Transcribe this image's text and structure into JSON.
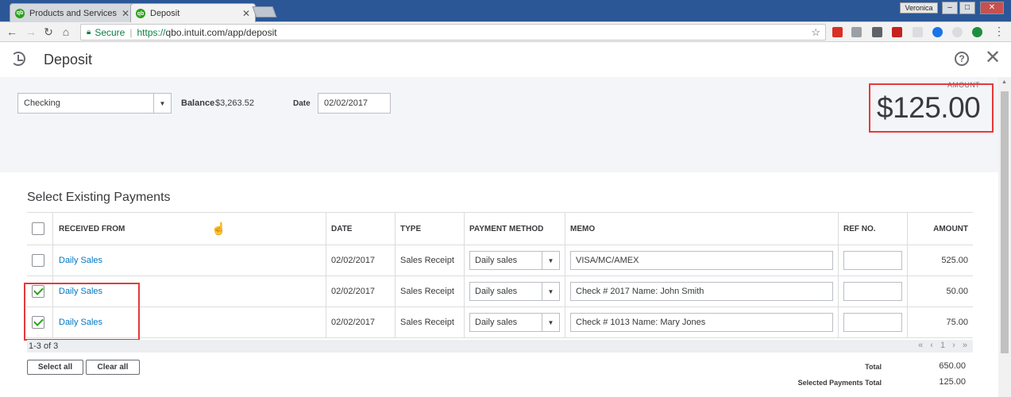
{
  "browser": {
    "tabs": [
      {
        "label": "Products and Services",
        "icon": "quickbooks-icon",
        "active": false
      },
      {
        "label": "Deposit",
        "icon": "quickbooks-icon",
        "active": true
      }
    ],
    "user": "Veronica",
    "secure_label": "Secure",
    "url_scheme": "https://",
    "url_rest": "qbo.intuit.com/app/deposit"
  },
  "header": {
    "title": "Deposit",
    "help_glyph": "?",
    "close_glyph": "✕"
  },
  "form": {
    "account": "Checking",
    "balance_label": "Balance",
    "balance_value": "$3,263.52",
    "date_label": "Date",
    "date_value": "02/02/2017",
    "amount_label": "AMOUNT",
    "amount_value": "$125.00"
  },
  "section_title": "Select Existing Payments",
  "table": {
    "headers": {
      "received_from": "RECEIVED FROM",
      "date": "DATE",
      "type": "TYPE",
      "payment_method": "PAYMENT METHOD",
      "memo": "MEMO",
      "ref_no": "REF NO.",
      "amount": "AMOUNT"
    },
    "rows": [
      {
        "checked": false,
        "received_from": "Daily Sales",
        "date": "02/02/2017",
        "type": "Sales Receipt",
        "payment_method": "Daily sales",
        "memo": "VISA/MC/AMEX",
        "ref_no": "",
        "amount": "525.00"
      },
      {
        "checked": true,
        "received_from": "Daily Sales",
        "date": "02/02/2017",
        "type": "Sales Receipt",
        "payment_method": "Daily sales",
        "memo": "Check # 2017 Name: John Smith",
        "ref_no": "",
        "amount": "50.00"
      },
      {
        "checked": true,
        "received_from": "Daily Sales",
        "date": "02/02/2017",
        "type": "Sales Receipt",
        "payment_method": "Daily sales",
        "memo": "Check # 1013 Name: Mary Jones",
        "ref_no": "",
        "amount": "75.00"
      }
    ]
  },
  "pager": {
    "count": "1-3 of 3",
    "nav": "« ‹ 1 › »"
  },
  "buttons": {
    "select_all": "Select all",
    "clear_all": "Clear all"
  },
  "totals": {
    "total_label": "Total",
    "total_value": "650.00",
    "selected_label": "Selected Payments Total",
    "selected_value": "125.00"
  },
  "colors": {
    "highlight": "#e53a3a",
    "link": "#0077c5",
    "brand_green": "#2ca01c"
  }
}
